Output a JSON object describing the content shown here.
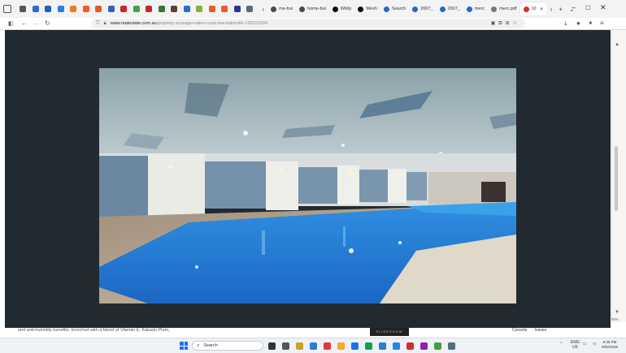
{
  "browser": {
    "tabs": [
      {
        "label": "me-bui",
        "color": "#4a4a4a"
      },
      {
        "label": "home-bui",
        "color": "#4a4a4a"
      },
      {
        "label": "Wildy",
        "color": "#111111"
      },
      {
        "label": "Mesh",
        "color": "#111111"
      },
      {
        "label": "Search",
        "color": "#2a66c9"
      },
      {
        "label": "2007_",
        "color": "#2a66c9"
      },
      {
        "label": "2007_",
        "color": "#2a66c9"
      },
      {
        "label": "merc",
        "color": "#2a66c9"
      },
      {
        "label": "merc.pdf",
        "color": "#777777"
      },
      {
        "label": "10",
        "color": "#d93025",
        "active": true
      }
    ],
    "pinned_colors": [
      "#555",
      "#2b6cd1",
      "#1e5fbf",
      "#2c7be5",
      "#f07c1b",
      "#f05a28",
      "#e8542a",
      "#3a5bc4",
      "#c62828",
      "#43a047",
      "#c62828",
      "#2e7d32",
      "#5d4037",
      "#2b6cd1",
      "#7cb342",
      "#f05a28",
      "#f05a28",
      "#283593",
      "#546e7a"
    ],
    "url_host": "www.realestate.com.au",
    "url_path": "/property-acreage+sales-rural-nsw-kalorville-150221504",
    "nav": {
      "back": "←",
      "forward": "→",
      "reload": "↻",
      "lock": "🔒"
    }
  },
  "page": {
    "body_snippet": "and anti-humidity benefits. Enriched with a blend of Vitamin E, Kakadu Plum,",
    "devtools": [
      "Console",
      "Issues"
    ],
    "gallery_label": "SLIDESHOW",
    "zoom": "90%"
  },
  "lightbox": {
    "background": "#212a30"
  },
  "taskbar": {
    "search_label": "Search",
    "lang_top": "ENG",
    "lang_bottom": "US",
    "time": "6:35 PM",
    "date": "9/02/2026",
    "app_colors": [
      "#333",
      "#555",
      "#c9a227",
      "#2b7cd3",
      "#e53935",
      "#f9a825",
      "#1a73e8",
      "#0f9d58",
      "#2b7cd3",
      "#1e88e5",
      "#d32f2f",
      "#8e24aa",
      "#43a047",
      "#546e7a"
    ]
  }
}
